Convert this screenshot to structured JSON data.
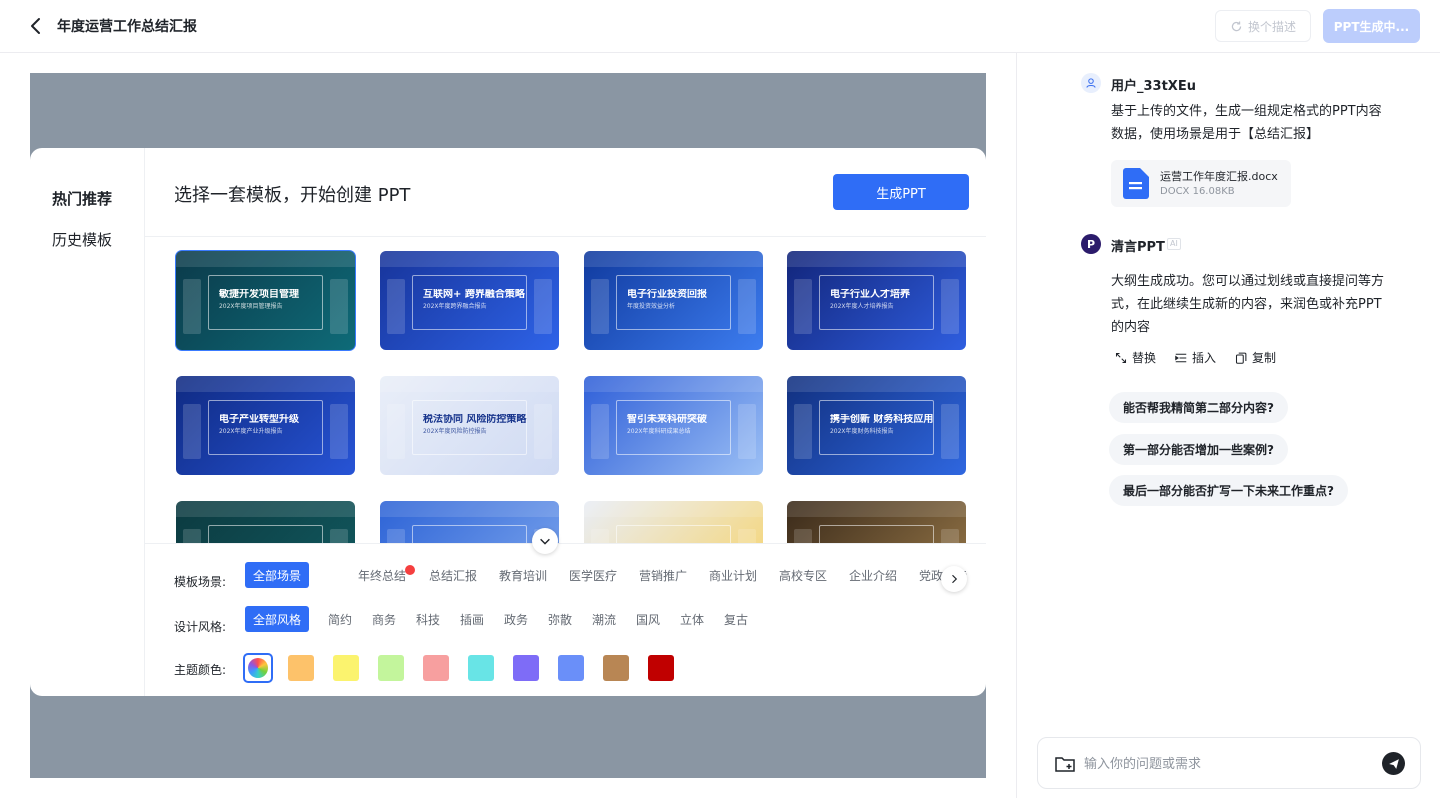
{
  "header": {
    "title": "年度运营工作总结汇报",
    "regen_label": "换个描述",
    "generating_label": "PPT生成中..."
  },
  "modal": {
    "sidebar": [
      "热门推荐",
      "历史模板"
    ],
    "title": "选择一套模板，开始创建 PPT",
    "generate_label": "生成PPT",
    "templates": [
      {
        "title": "敏捷开发项目管理",
        "sub": "202X年度项目管理报告",
        "color1": "#0b3a4a",
        "color2": "#0e6b78",
        "light": false
      },
      {
        "title": "互联网+ 跨界融合策略",
        "sub": "202X年度跨界融合报告",
        "color1": "#17349a",
        "color2": "#2e63e8",
        "light": false
      },
      {
        "title": "电子行业投资回报",
        "sub": "年度投资效益分析",
        "color1": "#103a9e",
        "color2": "#3d7df0",
        "light": false
      },
      {
        "title": "电子行业人才培养",
        "sub": "202X年度人才培养报告",
        "color1": "#12257a",
        "color2": "#2f5ee0",
        "light": false
      },
      {
        "title": "电子产业转型升级",
        "sub": "202X年度产业升级报告",
        "color1": "#0f2a82",
        "color2": "#2754d6",
        "light": false
      },
      {
        "title": "税法协同 风险防控策略",
        "sub": "202X年度风险防控报告",
        "color1": "#e9eef8",
        "color2": "#cfdaf3",
        "light": true
      },
      {
        "title": "智引未来科研突破",
        "sub": "202X年度科研成果总结",
        "color1": "#2f5fd8",
        "color2": "#9cc0f5",
        "light": false
      },
      {
        "title": "携手创新 财务科技应用",
        "sub": "202X年度财务科技报告",
        "color1": "#11307f",
        "color2": "#2f67e0",
        "light": false
      },
      {
        "title": "",
        "sub": "",
        "color1": "#0c3a40",
        "color2": "#115a60",
        "light": false
      },
      {
        "title": "",
        "sub": "",
        "color1": "#2d63d6",
        "color2": "#7fa8ee",
        "light": false
      },
      {
        "title": "",
        "sub": "",
        "color1": "#e9edf5",
        "color2": "#f6d36b",
        "light": true
      },
      {
        "title": "",
        "sub": "",
        "color1": "#3a2a1a",
        "color2": "#9a7a4a",
        "light": false
      }
    ],
    "filters": {
      "scene_label": "模板场景:",
      "scenes": [
        "全部场景",
        "年终总结",
        "总结汇报",
        "教育培训",
        "医学医疗",
        "营销推广",
        "商业计划",
        "高校专区",
        "企业介绍",
        "党政宣传"
      ],
      "style_label": "设计风格:",
      "styles": [
        "全部风格",
        "简约",
        "商务",
        "科技",
        "插画",
        "政务",
        "弥散",
        "潮流",
        "国风",
        "立体",
        "复古"
      ],
      "color_label": "主题颜色:",
      "colors": [
        "#fdc26a",
        "#fbf36e",
        "#c3f59c",
        "#f79f9f",
        "#68e4e6",
        "#7e6cf7",
        "#6a8ff9",
        "#b88654",
        "#c00000"
      ]
    }
  },
  "chat": {
    "user_name": "用户_33tXEu",
    "user_message": "基于上传的文件，生成一组规定格式的PPT内容数据，使用场景是用于【总结汇报】",
    "file": {
      "name": "运营工作年度汇报.docx",
      "meta": "DOCX  16.08KB"
    },
    "bot_name": "清言PPT",
    "bot_tag": "AI",
    "bot_avatar_letter": "P",
    "bot_message": "大纲生成成功。您可以通过划线或直接提问等方式，在此继续生成新的内容，来润色或补充PPT的内容",
    "actions": [
      "替换",
      "插入",
      "复制"
    ],
    "suggestions": [
      "能否帮我精简第二部分内容?",
      "第一部分能否增加一些案例?",
      "最后一部分能否扩写一下未来工作重点?"
    ],
    "input_placeholder": "输入你的问题或需求"
  },
  "icons": {
    "back": "chevron-left-icon",
    "regen": "refresh-icon",
    "file": "document-icon",
    "expand": "chevron-down-icon",
    "scroll": "chevron-right-icon",
    "folder": "folder-icon",
    "send": "send-icon"
  }
}
